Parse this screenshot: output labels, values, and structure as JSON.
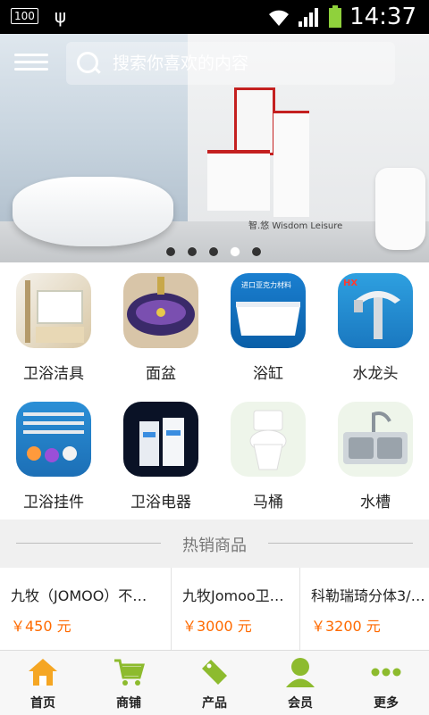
{
  "status_bar": {
    "battery_text": "100",
    "time": "14:37"
  },
  "search": {
    "placeholder": "搜索你喜欢的内容"
  },
  "banner": {
    "brand_text": "智.悠 Wisdom Leisure",
    "slide_count": 5,
    "active_slide": 4
  },
  "categories": [
    {
      "label": "卫浴洁具"
    },
    {
      "label": "面盆"
    },
    {
      "label": "浴缸"
    },
    {
      "label": "水龙头"
    },
    {
      "label": "卫浴挂件"
    },
    {
      "label": "卫浴电器"
    },
    {
      "label": "马桶"
    },
    {
      "label": "水槽"
    }
  ],
  "hot": {
    "title": "热销商品"
  },
  "products": [
    {
      "name": "九牧（JOMOO）不…",
      "price": "￥450 元"
    },
    {
      "name": "九牧Jomoo卫…",
      "price": "￥3000 元"
    },
    {
      "name": "科勒瑞琦分体3/…",
      "price": "￥3200 元"
    }
  ],
  "nav": [
    {
      "label": "首页"
    },
    {
      "label": "商铺"
    },
    {
      "label": "产品"
    },
    {
      "label": "会员"
    },
    {
      "label": "更多"
    }
  ],
  "colors": {
    "accent": "#ff6a00",
    "nav_icon": "#8dbb2e"
  }
}
